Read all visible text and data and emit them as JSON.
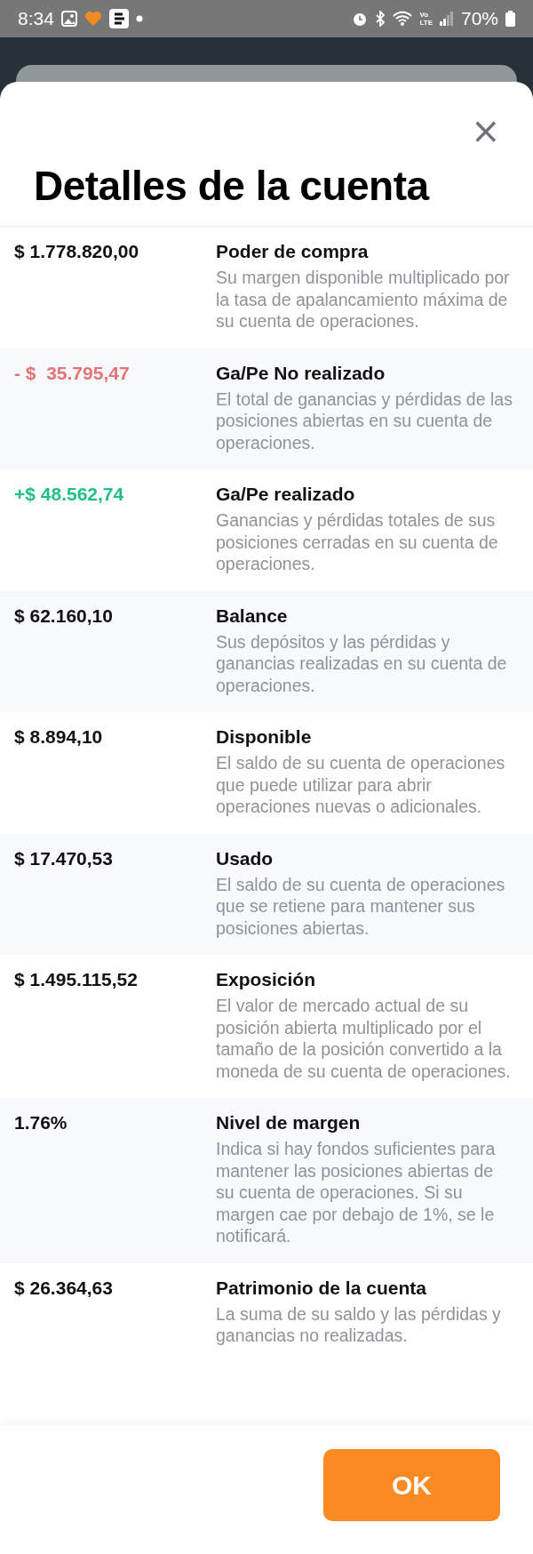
{
  "status_bar": {
    "time": "8:34",
    "volte": "Vo",
    "lte": "LTE",
    "battery": "70%"
  },
  "sheet": {
    "title": "Detalles de la cuenta",
    "close": "×"
  },
  "rows": [
    {
      "amount": "$ 1.778.820,00",
      "color": "#111111",
      "label": "Poder de compra",
      "description": "Su margen disponible multiplicado por la tasa de apalancamiento máxima de su cuenta de operaciones."
    },
    {
      "amount": "- $  35.795,47",
      "color": "#e57373",
      "label": "Ga/Pe No realizado",
      "description": "El total de ganancias y pérdidas de las posiciones abiertas en su cuenta de operaciones."
    },
    {
      "amount": "+$ 48.562,74",
      "color": "#1fbf87",
      "label": "Ga/Pe realizado",
      "description": "Ganancias y pérdidas totales de sus posiciones cerradas en su cuenta de operaciones."
    },
    {
      "amount": "$ 62.160,10",
      "color": "#111111",
      "label": "Balance",
      "description": "Sus depósitos y las pérdidas y ganancias realizadas en su cuenta de operaciones."
    },
    {
      "amount": "$ 8.894,10",
      "color": "#111111",
      "label": "Disponible",
      "description": "El saldo de su cuenta de operaciones que puede utilizar para abrir operaciones nuevas o adicionales."
    },
    {
      "amount": "$ 17.470,53",
      "color": "#111111",
      "label": "Usado",
      "description": "El saldo de su cuenta de operaciones que se retiene para mantener sus posiciones abiertas."
    },
    {
      "amount": "$ 1.495.115,52",
      "color": "#111111",
      "label": "Exposición",
      "description": "El valor de mercado actual de su posición abierta multiplicado por el tamaño de la posición convertido a la moneda de su cuenta de operaciones."
    },
    {
      "amount": "1.76%",
      "color": "#111111",
      "label": "Nivel de margen",
      "description": "Indica si hay fondos suficientes para mantener las posiciones abiertas de su cuenta de operaciones. Si su margen cae por debajo de 1%, se le notificará."
    },
    {
      "amount": "$ 26.364,63",
      "color": "#111111",
      "label": "Patrimonio de la cuenta",
      "description": "La suma de su saldo y las pérdidas y ganancias no realizadas."
    }
  ],
  "footer": {
    "ok_button": "OK"
  }
}
